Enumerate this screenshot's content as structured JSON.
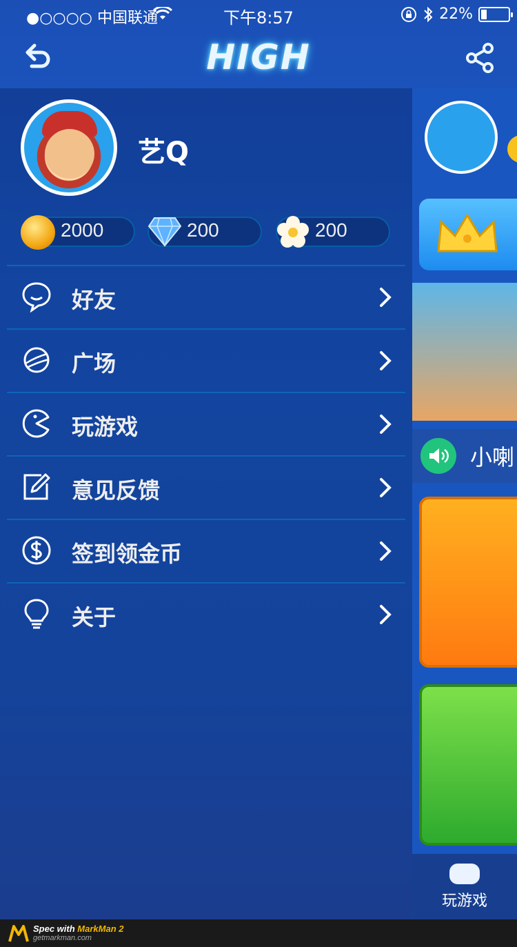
{
  "status_bar": {
    "carrier": "●○○○○ 中国联通",
    "time": "下午8:57",
    "battery": "22%",
    "battery_level": 0.22
  },
  "navbar": {
    "title": "HIGH"
  },
  "profile": {
    "username": "艺Q",
    "coins": "2000",
    "diamonds": "200",
    "flowers": "200"
  },
  "menu": [
    {
      "label": "好友",
      "icon": "chat-bubble-icon"
    },
    {
      "label": "广场",
      "icon": "planet-icon"
    },
    {
      "label": "玩游戏",
      "icon": "pacman-icon"
    },
    {
      "label": "意见反馈",
      "icon": "edit-icon"
    },
    {
      "label": "签到领金币",
      "icon": "dollar-icon"
    },
    {
      "label": "关于",
      "icon": "lightbulb-icon"
    }
  ],
  "background_page": {
    "speaker_text": "小喇",
    "tab_label": "玩游戏"
  },
  "footer": {
    "line1_prefix": "Spec with ",
    "line1_brand": "MarkMan 2",
    "line2": "getmarkman.com"
  },
  "colors": {
    "accent": "#00c0ff",
    "username": "#FFFFFF",
    "menu_text": "#eeeeee",
    "drawer_bg": "#061c5c"
  }
}
